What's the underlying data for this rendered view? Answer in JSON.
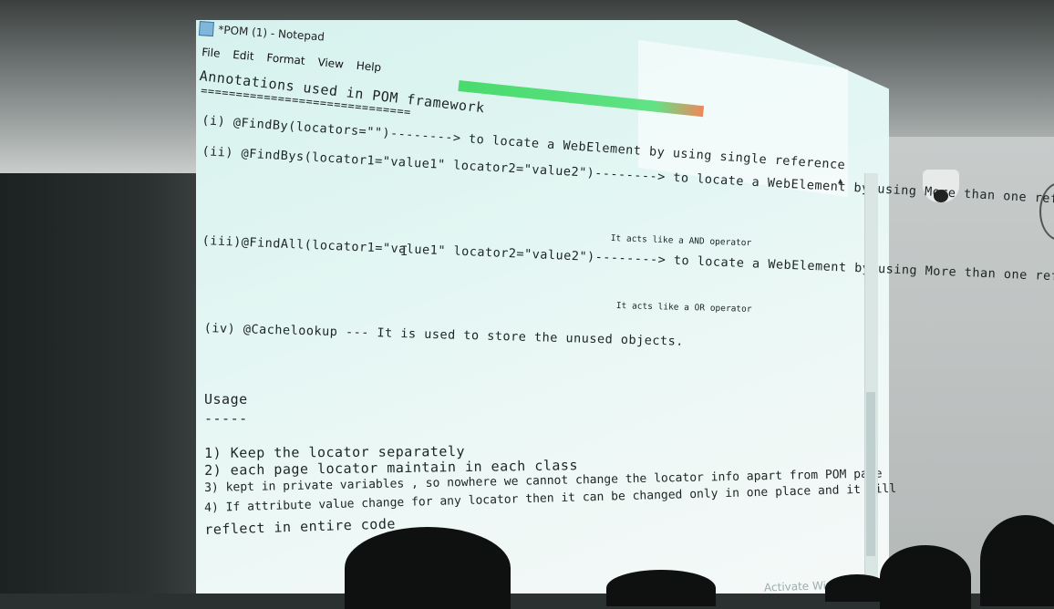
{
  "window": {
    "title": "*POM (1) - Notepad",
    "menu": [
      "File",
      "Edit",
      "Format",
      "View",
      "Help"
    ]
  },
  "content": {
    "heading": "Annotations used in POM framework",
    "heading_underline": "==============================",
    "item1": "(i) @FindBy(locators=\"\")--------> to locate a WebElement by using single reference",
    "item2a": "(ii) @FindBys(locator1=\"value1\" locator2=\"value2\")--------> to locate a WebElement by using More than one refer",
    "item2b": "It acts like a AND operator",
    "item3a": "(iii)@FindAll(locator1=\"value1\" locator2=\"value2\")--------> to locate a WebElement by using More than one refer",
    "item3b": "It acts like a OR operator",
    "item4": "(iv) @Cachelookup --- It is used to store the unused objects.",
    "usage_heading": "Usage",
    "usage_underline": "-----",
    "usage1": "1) Keep the locator separately",
    "usage2": "2) each page locator maintain in each class",
    "usage3": "3) kept in private variables , so nowhere we cannot change the locator info apart from POM page",
    "usage4a": "4) If attribute value change for any locator then it can be changed only in one place and it will",
    "usage4b": "reflect in entire code"
  },
  "watermark": "Activate Windo"
}
